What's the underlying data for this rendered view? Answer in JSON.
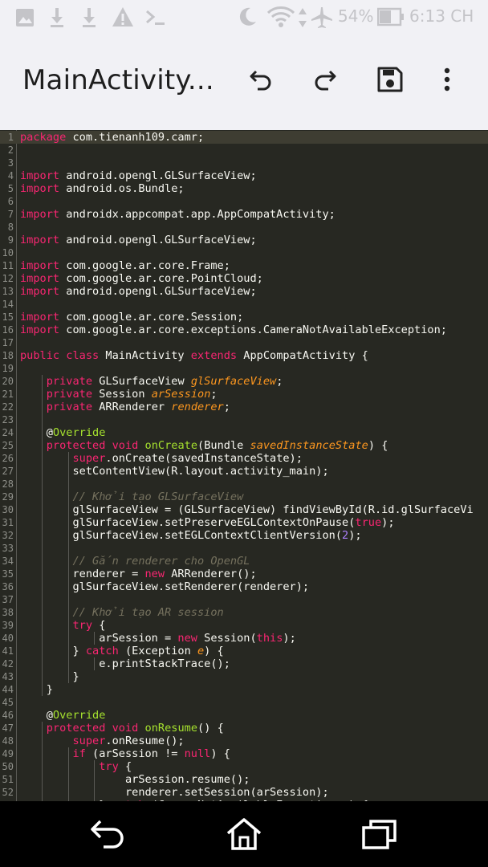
{
  "status_bar": {
    "battery": "54%",
    "time": "6:13 CH"
  },
  "app_bar": {
    "title": "MainActivity...",
    "icons": [
      "undo-icon",
      "redo-icon",
      "save-icon",
      "more-vert-icon"
    ]
  },
  "editor": {
    "lines": [
      "package com.tienanh109.camr;",
      "",
      "",
      "import android.opengl.GLSurfaceView;",
      "import android.os.Bundle;",
      "",
      "import androidx.appcompat.app.AppCompatActivity;",
      "",
      "import android.opengl.GLSurfaceView;",
      "",
      "import com.google.ar.core.Frame;",
      "import com.google.ar.core.PointCloud;",
      "import android.opengl.GLSurfaceView;",
      "",
      "import com.google.ar.core.Session;",
      "import com.google.ar.core.exceptions.CameraNotAvailableException;",
      "",
      "public class MainActivity extends AppCompatActivity {",
      "",
      "    private GLSurfaceView glSurfaceView;",
      "    private Session arSession;",
      "    private ARRenderer renderer;",
      "",
      "    @Override",
      "    protected void onCreate(Bundle savedInstanceState) {",
      "        super.onCreate(savedInstanceState);",
      "        setContentView(R.layout.activity_main);",
      "",
      "        // Khởi tạo GLSurfaceView",
      "        glSurfaceView = (GLSurfaceView) findViewById(R.id.glSurfaceVi",
      "        glSurfaceView.setPreserveEGLContextOnPause(true);",
      "        glSurfaceView.setEGLContextClientVersion(2);",
      "",
      "        // Gắn renderer cho OpenGL",
      "        renderer = new ARRenderer();",
      "        glSurfaceView.setRenderer(renderer);",
      "",
      "        // Khởi tạo AR session",
      "        try {",
      "            arSession = new Session(this);",
      "        } catch (Exception e) {",
      "            e.printStackTrace();",
      "        }",
      "    }",
      "",
      "    @Override",
      "    protected void onResume() {",
      "        super.onResume();",
      "        if (arSession != null) {",
      "            try {",
      "                arSession.resume();",
      "                renderer.setSession(arSession);",
      "            } catch (CameraNotAvailableException e) {"
    ]
  },
  "nav_bar": {
    "icons": [
      "back-icon",
      "home-icon",
      "recents-icon"
    ]
  },
  "colors": {
    "editor_bg": "#272822",
    "keyword": "#f92672",
    "type": "#66d9ef",
    "comment": "#75715e",
    "parameter": "#fd971f",
    "function": "#a6e22e",
    "number": "#ae81ff",
    "text": "#f8f8f2",
    "bar_bg": "#f1f1f5"
  }
}
